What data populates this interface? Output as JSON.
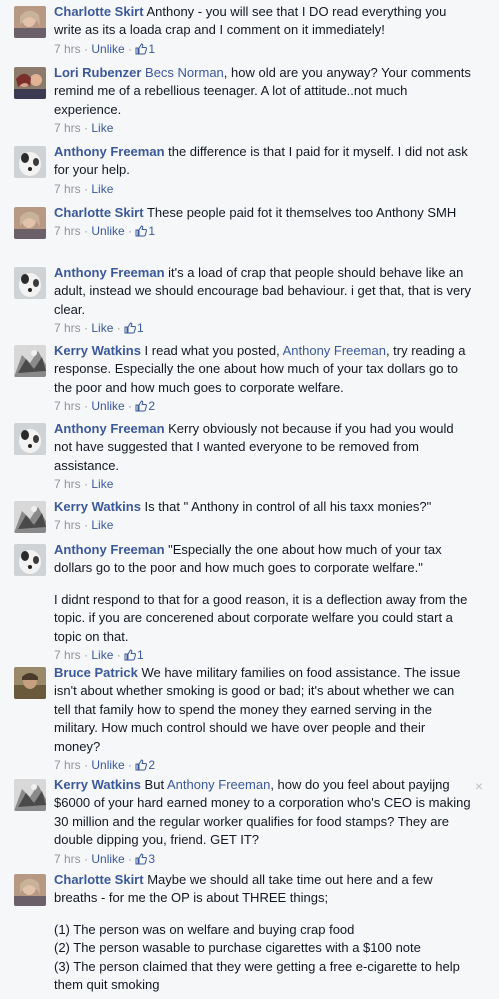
{
  "comments": [
    {
      "author": "Charlotte Skirt",
      "text": " Anthony - you will see that I DO read everything you write as its a loada crap and I comment on it immediately!",
      "time": "7 hrs",
      "action": "Unlike",
      "likes": "1"
    },
    {
      "author": "Lori Rubenzer",
      "mention": "Becs Norman",
      "text": ", how old are you anyway? Your comments remind me of a rebellious teenager. A lot of attitude..not much experience.",
      "time": "7 hrs",
      "action": "Like"
    },
    {
      "author": "Anthony Freeman",
      "text": " the difference is that I paid for it myself. I did not ask for your help.",
      "time": "7 hrs",
      "action": "Like"
    },
    {
      "author": "Charlotte Skirt",
      "text": " These people paid fot it themselves too Anthony SMH",
      "time": "7 hrs",
      "action": "Unlike",
      "likes": "1"
    },
    {
      "author": "Anthony Freeman",
      "text": " it's a load of crap that people should behave like an adult, instead we should encourage bad behaviour. i get that, that is very clear.",
      "time": "7 hrs",
      "action": "Like",
      "likes": "1"
    },
    {
      "author": "Kerry Watkins",
      "text": " I read what you posted, ",
      "mention": "Anthony Freeman",
      "text_after": ", try reading a response. Especially the one about how much of your tax dollars go to the poor and how much goes to corporate welfare.",
      "time": "7 hrs",
      "action": "Unlike",
      "likes": "2"
    },
    {
      "author": "Anthony Freeman",
      "text": " Kerry obviously not because if you had you would not have suggested that I wanted everyone to be removed from assistance.",
      "time": "7 hrs",
      "action": "Like"
    },
    {
      "author": "Kerry Watkins",
      "text": " Is that \" Anthony in control of all his taxx monies?\"",
      "time": "7 hrs",
      "action": "Like"
    },
    {
      "author": "Anthony Freeman",
      "text": " \"Especially the one about how much of your tax dollars go to the poor and how much goes to corporate welfare.\"",
      "para": "I didnt respond to that for a good reason, it is a deflection away from the topic. if you are concerened about corporate welfare you could start a topic on that.",
      "time": "7 hrs",
      "action": "Like",
      "likes": "1"
    },
    {
      "author": "Bruce Patrick",
      "text": " We have military families on food assistance. The issue isn't about whether smoking is good or bad; it's about whether we can tell that family how to spend the money they earned serving in the military. How much control should we have over people and their money?",
      "time": "7 hrs",
      "action": "Unlike",
      "likes": "2"
    },
    {
      "author": "Kerry Watkins",
      "text": " But ",
      "mention": "Anthony Freeman",
      "text_after": ", how do you feel about payijng $6000 of your hard earned money to a corporation who's CEO is making 30 million and the regular worker qualifies for food stamps? They are double dipping you, friend. GET IT?",
      "time": "7 hrs",
      "action": "Unlike",
      "likes": "3",
      "close": "×"
    },
    {
      "author": "Charlotte Skirt",
      "text": " Maybe we should all take time out here and a few breaths - for me the OP is about THREE things;",
      "lines": [
        "(1) The person was on welfare and buying crap food",
        "(2) The person wasable to purchase cigarettes with a $100 note",
        "(3) The person claimed that they were getting a free e-cigarette to help them quit smoking"
      ]
    }
  ],
  "meta_separator": " · ",
  "colors": {
    "link": "#3b5998",
    "meta": "#90949c",
    "text": "#141823",
    "background": "#f6f7f9"
  },
  "icons": {
    "like": "thumbs-up-icon",
    "close": "close-icon"
  }
}
